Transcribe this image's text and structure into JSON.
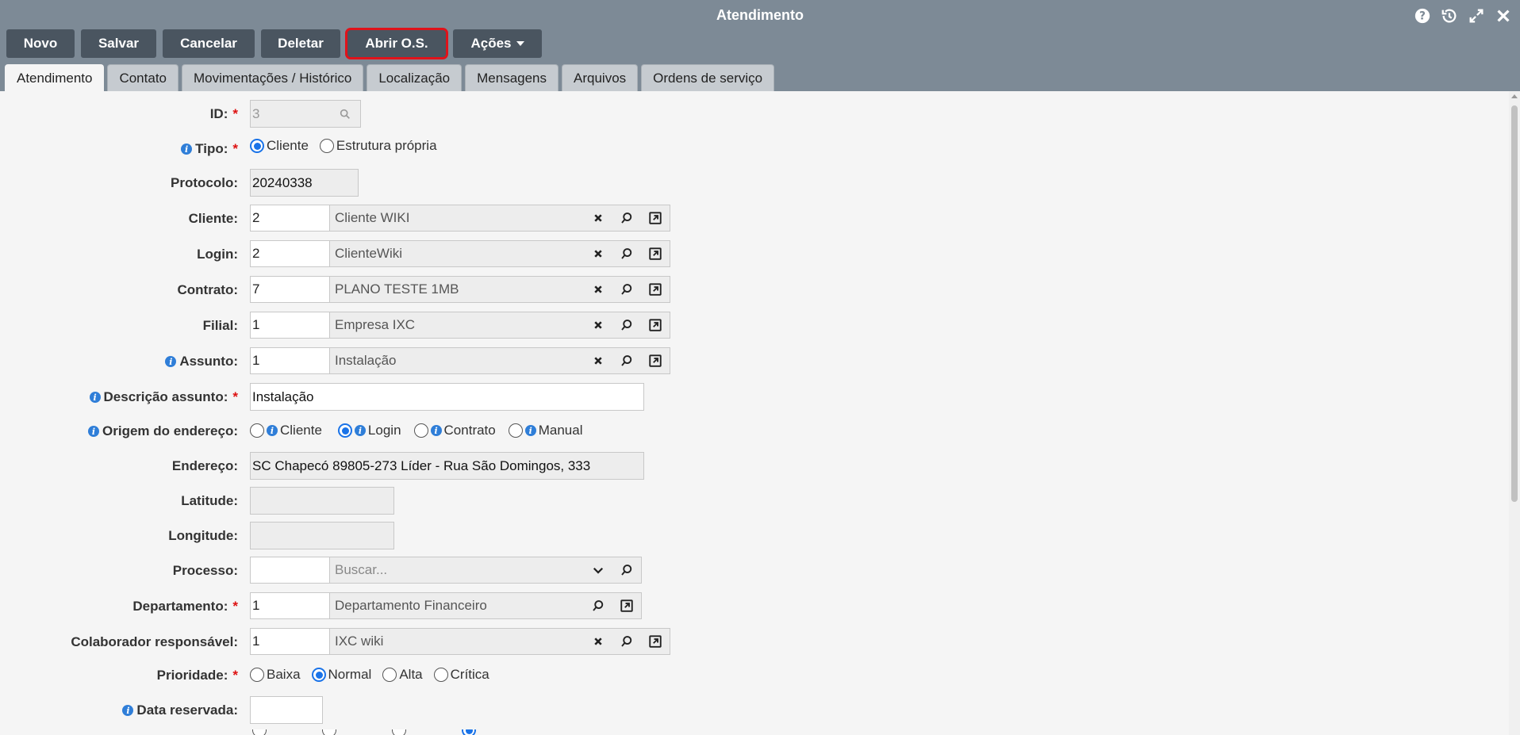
{
  "window": {
    "title": "Atendimento"
  },
  "toolbar": {
    "novo": "Novo",
    "salvar": "Salvar",
    "cancelar": "Cancelar",
    "deletar": "Deletar",
    "abrir_os": "Abrir O.S.",
    "acoes": "Ações"
  },
  "tabs": [
    "Atendimento",
    "Contato",
    "Movimentações / Histórico",
    "Localização",
    "Mensagens",
    "Arquivos",
    "Ordens de serviço"
  ],
  "form": {
    "id": {
      "label": "ID:",
      "value": "3"
    },
    "tipo": {
      "label": "Tipo:",
      "options": [
        "Cliente",
        "Estrutura própria"
      ],
      "selected": "Cliente"
    },
    "protocolo": {
      "label": "Protocolo:",
      "value": "20240338"
    },
    "cliente": {
      "label": "Cliente:",
      "code": "2",
      "desc": "Cliente WIKI"
    },
    "login": {
      "label": "Login:",
      "code": "2",
      "desc": "ClienteWiki"
    },
    "contrato": {
      "label": "Contrato:",
      "code": "7",
      "desc": "PLANO TESTE 1MB"
    },
    "filial": {
      "label": "Filial:",
      "code": "1",
      "desc": "Empresa IXC"
    },
    "assunto": {
      "label": "Assunto:",
      "code": "1",
      "desc": "Instalação"
    },
    "descricao_assunto": {
      "label": "Descrição assunto:",
      "value": "Instalação"
    },
    "origem_endereco": {
      "label": "Origem do endereço:",
      "options": [
        "Cliente",
        "Login",
        "Contrato",
        "Manual"
      ],
      "selected": "Login"
    },
    "endereco": {
      "label": "Endereço:",
      "value": "SC Chapecó 89805-273 Líder - Rua São Domingos, 333"
    },
    "latitude": {
      "label": "Latitude:",
      "value": ""
    },
    "longitude": {
      "label": "Longitude:",
      "value": ""
    },
    "processo": {
      "label": "Processo:",
      "code": "",
      "placeholder": "Buscar..."
    },
    "departamento": {
      "label": "Departamento:",
      "code": "1",
      "desc": "Departamento Financeiro"
    },
    "colaborador": {
      "label": "Colaborador responsável:",
      "code": "1",
      "desc": "IXC wiki"
    },
    "prioridade": {
      "label": "Prioridade:",
      "options": [
        "Baixa",
        "Normal",
        "Alta",
        "Crítica"
      ],
      "selected": "Normal"
    },
    "data_reservada": {
      "label": "Data reservada:",
      "value": ""
    }
  },
  "colors": {
    "header": "#7d8a96",
    "button": "#4a5560",
    "highlight": "#e0121a",
    "radio": "#1a73e8",
    "info": "#2f7ed8",
    "required": "#dd1111"
  }
}
